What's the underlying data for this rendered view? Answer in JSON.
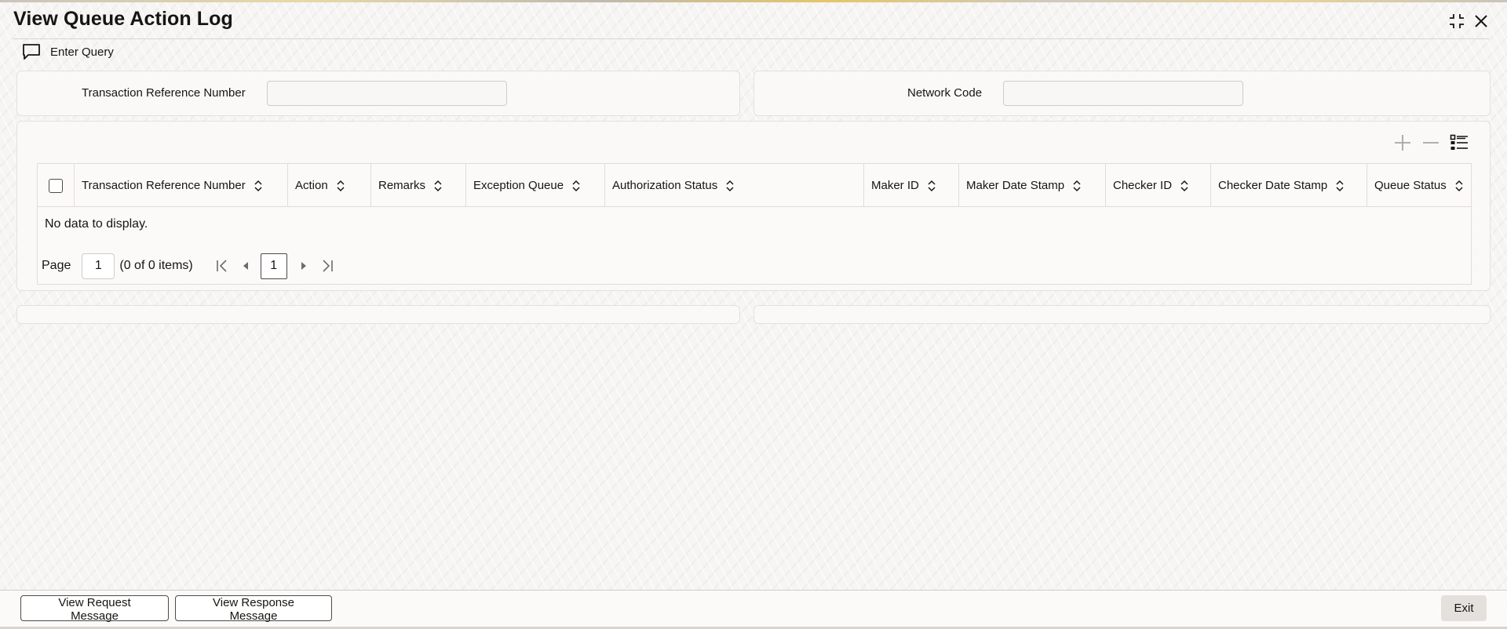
{
  "window": {
    "title": "View Queue Action Log"
  },
  "toolbar": {
    "enter_query_label": "Enter Query"
  },
  "query": {
    "transaction_ref_label": "Transaction Reference Number",
    "transaction_ref_value": "",
    "network_code_label": "Network Code",
    "network_code_value": ""
  },
  "grid": {
    "columns": [
      "Transaction Reference Number",
      "Action",
      "Remarks",
      "Exception Queue",
      "Authorization Status",
      "Maker ID",
      "Maker Date Stamp",
      "Checker ID",
      "Checker Date Stamp",
      "Queue Status"
    ],
    "empty_message": "No data to display.",
    "pager": {
      "page_label": "Page",
      "page_value": "1",
      "count_text": "(0 of 0 items)",
      "current_page": "1"
    }
  },
  "footer": {
    "view_request_label": "View Request Message",
    "view_response_label": "View Response Message",
    "exit_label": "Exit"
  },
  "icons": {
    "toolbar": "chat-bubble-icon",
    "add": "plus-icon",
    "remove": "minus-icon",
    "columns": "list-settings-icon",
    "minimize": "minimize-icon",
    "close": "close-icon",
    "sort": "sort-icon"
  }
}
